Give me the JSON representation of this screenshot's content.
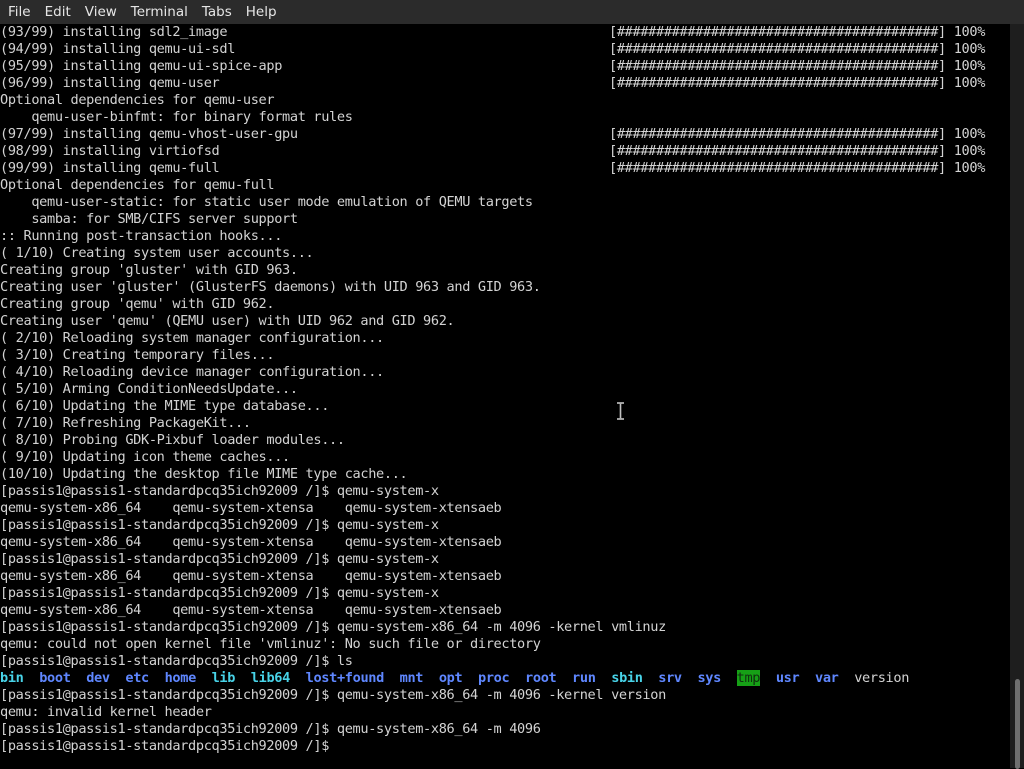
{
  "menubar": {
    "items": [
      "File",
      "Edit",
      "View",
      "Terminal",
      "Tabs",
      "Help"
    ]
  },
  "terminal": {
    "install_lines": [
      {
        "text": "(93/99) installing sdl2_image",
        "progress": "[#########################################] 100%"
      },
      {
        "text": "(94/99) installing qemu-ui-sdl",
        "progress": "[#########################################] 100%"
      },
      {
        "text": "(95/99) installing qemu-ui-spice-app",
        "progress": "[#########################################] 100%"
      },
      {
        "text": "(96/99) installing qemu-user",
        "progress": "[#########################################] 100%"
      },
      {
        "text": "Optional dependencies for qemu-user"
      },
      {
        "text": "    qemu-user-binfmt: for binary format rules"
      },
      {
        "text": "(97/99) installing qemu-vhost-user-gpu",
        "progress": "[#########################################] 100%"
      },
      {
        "text": "(98/99) installing virtiofsd",
        "progress": "[#########################################] 100%"
      },
      {
        "text": "(99/99) installing qemu-full",
        "progress": "[#########################################] 100%"
      },
      {
        "text": "Optional dependencies for qemu-full"
      },
      {
        "text": "    qemu-user-static: for static user mode emulation of QEMU targets"
      },
      {
        "text": "    samba: for SMB/CIFS server support"
      },
      {
        "text": ":: Running post-transaction hooks..."
      },
      {
        "text": "( 1/10) Creating system user accounts..."
      },
      {
        "text": "Creating group 'gluster' with GID 963."
      },
      {
        "text": "Creating user 'gluster' (GlusterFS daemons) with UID 963 and GID 963."
      },
      {
        "text": "Creating group 'qemu' with GID 962."
      },
      {
        "text": "Creating user 'qemu' (QEMU user) with UID 962 and GID 962."
      },
      {
        "text": "( 2/10) Reloading system manager configuration..."
      },
      {
        "text": "( 3/10) Creating temporary files..."
      },
      {
        "text": "( 4/10) Reloading device manager configuration..."
      },
      {
        "text": "( 5/10) Arming ConditionNeedsUpdate..."
      },
      {
        "text": "( 6/10) Updating the MIME type database..."
      },
      {
        "text": "( 7/10) Refreshing PackageKit..."
      },
      {
        "text": "( 8/10) Probing GDK-Pixbuf loader modules..."
      },
      {
        "text": "( 9/10) Updating icon theme caches..."
      },
      {
        "text": "(10/10) Updating the desktop file MIME type cache..."
      },
      {
        "text": "[passis1@passis1-standardpcq35ich92009 /]$ qemu-system-x"
      },
      {
        "text": "qemu-system-x86_64    qemu-system-xtensa    qemu-system-xtensaeb"
      },
      {
        "text": "[passis1@passis1-standardpcq35ich92009 /]$ qemu-system-x"
      },
      {
        "text": "qemu-system-x86_64    qemu-system-xtensa    qemu-system-xtensaeb"
      },
      {
        "text": "[passis1@passis1-standardpcq35ich92009 /]$ qemu-system-x"
      },
      {
        "text": "qemu-system-x86_64    qemu-system-xtensa    qemu-system-xtensaeb"
      },
      {
        "text": "[passis1@passis1-standardpcq35ich92009 /]$ qemu-system-x"
      },
      {
        "text": "qemu-system-x86_64    qemu-system-xtensa    qemu-system-xtensaeb"
      },
      {
        "text": "[passis1@passis1-standardpcq35ich92009 /]$ qemu-system-x86_64 -m 4096 -kernel vmlinuz"
      },
      {
        "text": "qemu: could not open kernel file 'vmlinuz': No such file or directory"
      },
      {
        "text": "[passis1@passis1-standardpcq35ich92009 /]$ ls"
      }
    ],
    "ls_output": [
      {
        "name": "bin",
        "kind": "exe"
      },
      {
        "name": "boot",
        "kind": "dir"
      },
      {
        "name": "dev",
        "kind": "dir"
      },
      {
        "name": "etc",
        "kind": "dir"
      },
      {
        "name": "home",
        "kind": "dir"
      },
      {
        "name": "lib",
        "kind": "exe"
      },
      {
        "name": "lib64",
        "kind": "exe"
      },
      {
        "name": "lost+found",
        "kind": "dir"
      },
      {
        "name": "mnt",
        "kind": "dir"
      },
      {
        "name": "opt",
        "kind": "dir"
      },
      {
        "name": "proc",
        "kind": "dir"
      },
      {
        "name": "root",
        "kind": "dir"
      },
      {
        "name": "run",
        "kind": "dir"
      },
      {
        "name": "sbin",
        "kind": "exe"
      },
      {
        "name": "srv",
        "kind": "dir"
      },
      {
        "name": "sys",
        "kind": "dir"
      },
      {
        "name": "tmp",
        "kind": "tmp"
      },
      {
        "name": "usr",
        "kind": "dir"
      },
      {
        "name": "var",
        "kind": "dir"
      },
      {
        "name": "version",
        "kind": "file"
      }
    ],
    "tail_lines": [
      "[passis1@passis1-standardpcq35ich92009 /]$ qemu-system-x86_64 -m 4096 -kernel version",
      "qemu: invalid kernel header",
      "[passis1@passis1-standardpcq35ich92009 /]$ qemu-system-x86_64 -m 4096",
      "[passis1@passis1-standardpcq35ich92009 /]$ "
    ]
  },
  "colors": {
    "background": "#000000",
    "text": "#d3d3d3",
    "directory": "#5f87ff",
    "executable_link": "#48d3e8",
    "tmp_highlight": "#16a016",
    "menubar": "#2b2b2b"
  },
  "icons": {
    "cursor": "text-cursor-icon"
  }
}
